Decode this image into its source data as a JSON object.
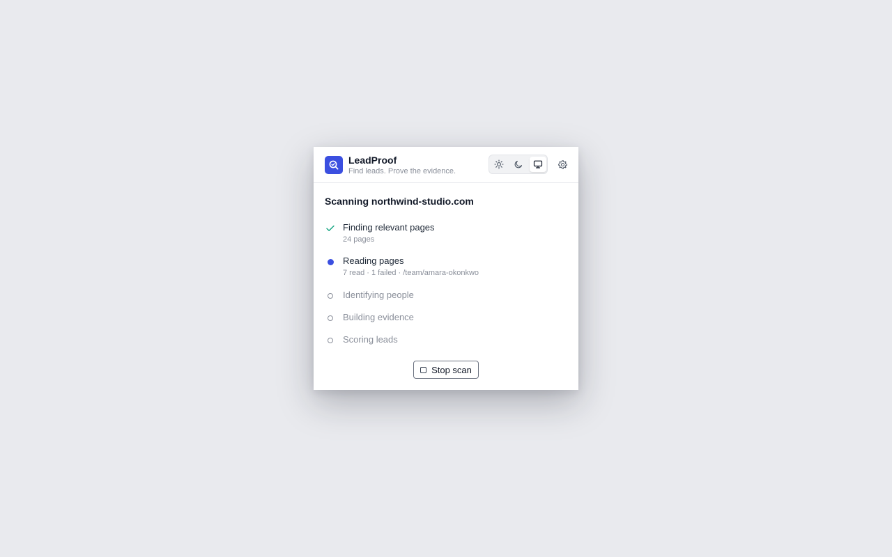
{
  "header": {
    "brand_name": "LeadProof",
    "tagline": "Find leads. Prove the evidence.",
    "logo_icon": "magnifier-check-icon",
    "theme_options": [
      {
        "name": "light",
        "icon": "sun-icon",
        "active": false
      },
      {
        "name": "dark",
        "icon": "moon-icon",
        "active": false
      },
      {
        "name": "system",
        "icon": "monitor-icon",
        "active": true
      }
    ],
    "settings_icon": "gear-icon"
  },
  "scan": {
    "title": "Scanning northwind-studio.com",
    "steps": [
      {
        "label": "Finding relevant pages",
        "detail": "24 pages",
        "status": "done"
      },
      {
        "label": "Reading pages",
        "detail": "7 read · 1 failed · /team/amara-okonkwo",
        "status": "active"
      },
      {
        "label": "Identifying people",
        "detail": "",
        "status": "pending"
      },
      {
        "label": "Building evidence",
        "detail": "",
        "status": "pending"
      },
      {
        "label": "Scoring leads",
        "detail": "",
        "status": "pending"
      }
    ],
    "stop_label": "Stop scan"
  },
  "colors": {
    "accent": "#3b4fe0",
    "done": "#10a37f",
    "muted": "#8a8f9a",
    "background": "#e9eaee"
  }
}
